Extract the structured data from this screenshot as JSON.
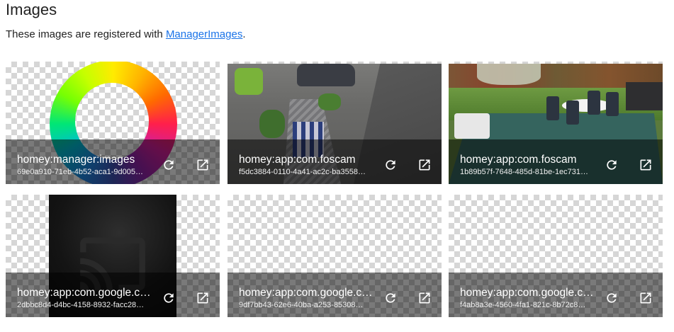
{
  "page": {
    "title": "Images",
    "description_prefix": "These images are registered with ",
    "description_link": "ManagerImages",
    "description_suffix": "."
  },
  "images": [
    {
      "name": "homey:manager:images",
      "uid": "69e0a910-71eb-4b52-aca1-9d005…",
      "preview": "rainbow-ring-logo"
    },
    {
      "name": "homey:app:com.foscam",
      "uid": "f5dc3884-0110-4a41-ac2c-ba3558…",
      "preview": "camera-driveway"
    },
    {
      "name": "homey:app:com.foscam",
      "uid": "1b89b57f-7648-485d-81be-1ec731…",
      "preview": "camera-garden"
    },
    {
      "name": "homey:app:com.google.c…",
      "uid": "2dbbc8d4-d4bc-4158-8932-facc28…",
      "preview": "cast-logo"
    },
    {
      "name": "homey:app:com.google.c…",
      "uid": "9df7bb43-62e6-40ba-a253-85308…",
      "preview": "empty"
    },
    {
      "name": "homey:app:com.google.c…",
      "uid": "f4ab8a3e-4560-4fa1-821c-8b72c8…",
      "preview": "empty"
    }
  ],
  "icons": {
    "refresh": "refresh-icon",
    "open": "open-in-new-icon"
  }
}
